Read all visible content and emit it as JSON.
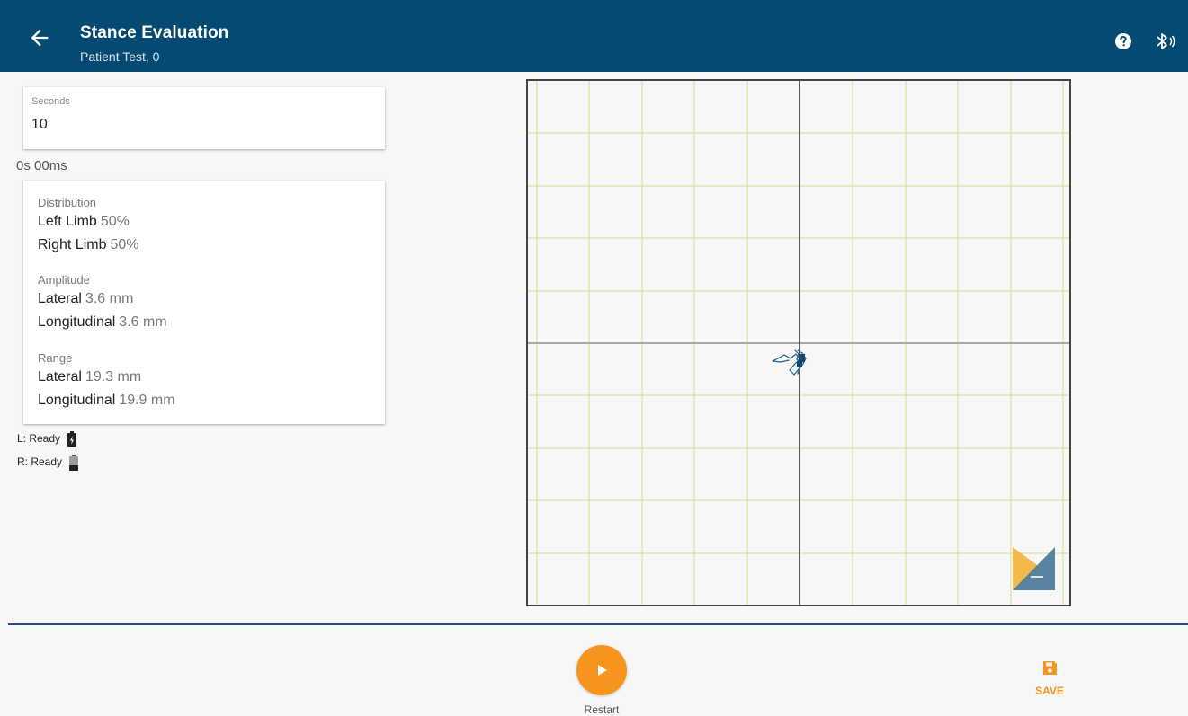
{
  "header": {
    "title": "Stance Evaluation",
    "subtitle": "Patient Test, 0",
    "back_icon": "arrow-left-icon",
    "help_icon": "help-circle-icon",
    "bluetooth_icon": "bluetooth-connected-icon",
    "background_color": "#054a72"
  },
  "seconds_field": {
    "label": "Seconds",
    "value": "10"
  },
  "timer": "0s 00ms",
  "stats": {
    "distribution": {
      "label": "Distribution",
      "left_label": "Left Limb",
      "left_value": "50%",
      "right_label": "Right Limb",
      "right_value": "50%"
    },
    "amplitude": {
      "label": "Amplitude",
      "lateral_label": "Lateral",
      "lateral_value": "3.6 mm",
      "longitudinal_label": "Longitudinal",
      "longitudinal_value": "3.6 mm"
    },
    "range": {
      "label": "Range",
      "lateral_label": "Lateral",
      "lateral_value": "19.3 mm",
      "longitudinal_label": "Longitudinal",
      "longitudinal_value": "19.9 mm"
    }
  },
  "devices": {
    "left": "L: Ready",
    "left_battery_icon": "battery-charging-icon",
    "right": "R: Ready",
    "right_battery_icon": "battery-icon"
  },
  "footer": {
    "restart_label": "Restart",
    "play_icon": "play-icon",
    "save_label": "SAVE",
    "save_icon": "floppy-disk-icon",
    "accent_color": "#f6941e"
  }
}
